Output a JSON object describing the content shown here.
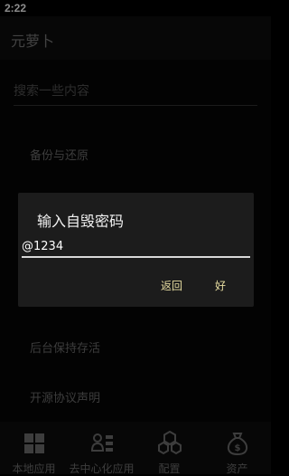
{
  "status_bar": {
    "time": "2:22"
  },
  "app_bar": {
    "title": "元萝卜"
  },
  "search": {
    "placeholder": "搜索一些内容"
  },
  "settings": {
    "items": [
      {
        "label": "备份与还原"
      },
      {
        "label": "后台保持存活"
      },
      {
        "label": "开源协议声明"
      }
    ]
  },
  "dialog": {
    "title": "输入自毁密码",
    "input_value": "@1234",
    "cancel_label": "返回",
    "ok_label": "好"
  },
  "bottom_nav": {
    "items": [
      {
        "label": "本地应用",
        "icon": "grid-icon"
      },
      {
        "label": "去中心化应用",
        "icon": "decentralized-icon"
      },
      {
        "label": "配置",
        "icon": "hexagon-settings-icon"
      },
      {
        "label": "资产",
        "icon": "money-bag-icon"
      }
    ]
  },
  "colors": {
    "dialog_button": "#e6dca0",
    "dialog_bg": "#1c1c1c",
    "nav_bg": "#0d0d0d"
  }
}
